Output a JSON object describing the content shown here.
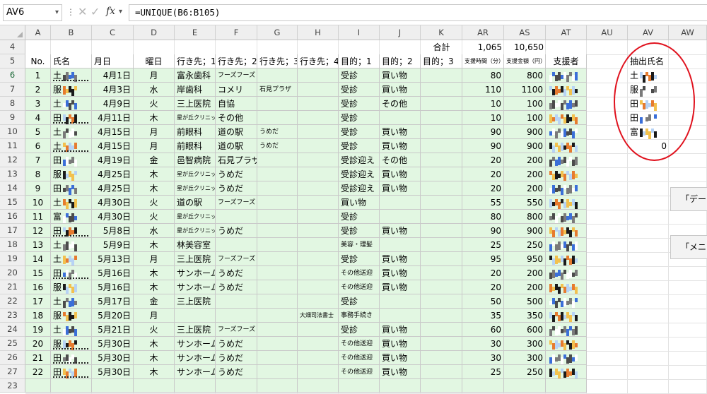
{
  "formula_bar": {
    "name_box": "AV6",
    "fx": "fx",
    "formula": "=UNIQUE(B6:B105)"
  },
  "columns": [
    {
      "key": "A",
      "label": "A"
    },
    {
      "key": "B",
      "label": "B"
    },
    {
      "key": "C",
      "label": "C"
    },
    {
      "key": "D",
      "label": "D"
    },
    {
      "key": "E",
      "label": "E"
    },
    {
      "key": "F",
      "label": "F"
    },
    {
      "key": "G",
      "label": "G"
    },
    {
      "key": "H",
      "label": "H"
    },
    {
      "key": "I",
      "label": "I"
    },
    {
      "key": "J",
      "label": "J"
    },
    {
      "key": "K",
      "label": "K"
    },
    {
      "key": "AR",
      "label": "AR"
    },
    {
      "key": "AS",
      "label": "AS"
    },
    {
      "key": "AT",
      "label": "AT"
    },
    {
      "key": "AU",
      "label": "AU"
    },
    {
      "key": "AV",
      "label": "AV"
    },
    {
      "key": "AW",
      "label": "AW"
    }
  ],
  "totals": {
    "label": "合計",
    "time": "1,065",
    "amount": "10,650"
  },
  "headers": {
    "no": "No.",
    "name": "氏名",
    "date": "月日",
    "weekday": "曜日",
    "dest1": "行き先；1",
    "dest2": "行き先；2",
    "dest3": "行き先；3",
    "dest4": "行き先；4",
    "purpose1": "目的；1",
    "purpose2": "目的；2",
    "purpose3": "目的；3",
    "time": "支援時間（分）",
    "amount": "支援金額（円）",
    "supporter": "支援者"
  },
  "extract": {
    "title": "抽出氏名",
    "names": [
      "土",
      "服",
      "田",
      "田",
      "富"
    ],
    "zero": "0"
  },
  "side_buttons": [
    "「デー",
    "「メニ"
  ],
  "rows": [
    {
      "row": "6",
      "no": "1",
      "name": "土",
      "date": "4月1日",
      "wd": "月",
      "d1": "富永歯科",
      "d2": "フーズフーズ",
      "d3": "",
      "d4": "",
      "p1": "受診",
      "p2": "買い物",
      "time": "80",
      "amt": "800"
    },
    {
      "row": "7",
      "no": "2",
      "name": "服",
      "date": "4月3日",
      "wd": "水",
      "d1": "岸歯科",
      "d2": "コメリ",
      "d3": "石見プラザ",
      "d4": "",
      "p1": "受診",
      "p2": "買い物",
      "time": "110",
      "amt": "1100"
    },
    {
      "row": "8",
      "no": "3",
      "name": "土",
      "date": "4月9日",
      "wd": "火",
      "d1": "三上医院",
      "d2": "自協",
      "d3": "",
      "d4": "",
      "p1": "受診",
      "p2": "その他",
      "time": "10",
      "amt": "100"
    },
    {
      "row": "9",
      "no": "4",
      "name": "田",
      "date": "4月11日",
      "wd": "木",
      "d1": "星が丘クリニック",
      "d2": "その他",
      "d3": "",
      "d4": "",
      "p1": "受診",
      "p2": "",
      "time": "10",
      "amt": "100"
    },
    {
      "row": "10",
      "no": "5",
      "name": "土",
      "date": "4月15日",
      "wd": "月",
      "d1": "前眼科",
      "d2": "道の駅",
      "d3": "うめだ",
      "d4": "",
      "p1": "受診",
      "p2": "買い物",
      "time": "90",
      "amt": "900"
    },
    {
      "row": "11",
      "no": "6",
      "name": "土",
      "date": "4月15日",
      "wd": "月",
      "d1": "前眼科",
      "d2": "道の駅",
      "d3": "うめだ",
      "d4": "",
      "p1": "受診",
      "p2": "買い物",
      "time": "90",
      "amt": "900"
    },
    {
      "row": "12",
      "no": "7",
      "name": "田",
      "date": "4月19日",
      "wd": "金",
      "d1": "邑智病院",
      "d2": "石見プラザ",
      "d3": "",
      "d4": "",
      "p1": "受診迎え",
      "p2": "その他",
      "time": "20",
      "amt": "200"
    },
    {
      "row": "13",
      "no": "8",
      "name": "服",
      "date": "4月25日",
      "wd": "木",
      "d1": "星が丘クリニック",
      "d2": "うめだ",
      "d3": "",
      "d4": "",
      "p1": "受診迎え",
      "p2": "買い物",
      "time": "20",
      "amt": "200"
    },
    {
      "row": "14",
      "no": "9",
      "name": "田",
      "date": "4月25日",
      "wd": "木",
      "d1": "星が丘クリニック",
      "d2": "うめだ",
      "d3": "",
      "d4": "",
      "p1": "受診迎え",
      "p2": "買い物",
      "time": "20",
      "amt": "200"
    },
    {
      "row": "15",
      "no": "10",
      "name": "土",
      "date": "4月30日",
      "wd": "火",
      "d1": "道の駅",
      "d2": "フーズフーズ",
      "d3": "",
      "d4": "",
      "p1": "買い物",
      "p2": "",
      "time": "55",
      "amt": "550"
    },
    {
      "row": "16",
      "no": "11",
      "name": "富",
      "date": "4月30日",
      "wd": "火",
      "d1": "星が丘クリニック",
      "d2": "",
      "d3": "",
      "d4": "",
      "p1": "受診",
      "p2": "",
      "time": "80",
      "amt": "800"
    },
    {
      "row": "17",
      "no": "12",
      "name": "田",
      "date": "5月8日",
      "wd": "水",
      "d1": "星が丘クリニック",
      "d2": "うめだ",
      "d3": "",
      "d4": "",
      "p1": "受診",
      "p2": "買い物",
      "time": "90",
      "amt": "900"
    },
    {
      "row": "18",
      "no": "13",
      "name": "土",
      "date": "5月9日",
      "wd": "木",
      "d1": "林美容室",
      "d2": "",
      "d3": "",
      "d4": "",
      "p1": "美容・理髪",
      "p2": "",
      "time": "25",
      "amt": "250"
    },
    {
      "row": "19",
      "no": "14",
      "name": "土",
      "date": "5月13日",
      "wd": "月",
      "d1": "三上医院",
      "d2": "フーズフーズ",
      "d3": "",
      "d4": "",
      "p1": "受診",
      "p2": "買い物",
      "time": "95",
      "amt": "950"
    },
    {
      "row": "20",
      "no": "15",
      "name": "田",
      "date": "5月16日",
      "wd": "木",
      "d1": "サンホーム",
      "d2": "うめだ",
      "d3": "",
      "d4": "",
      "p1": "その他送迎",
      "p2": "買い物",
      "time": "20",
      "amt": "200"
    },
    {
      "row": "21",
      "no": "16",
      "name": "服",
      "date": "5月16日",
      "wd": "木",
      "d1": "サンホーム",
      "d2": "うめだ",
      "d3": "",
      "d4": "",
      "p1": "その他送迎",
      "p2": "買い物",
      "time": "20",
      "amt": "200"
    },
    {
      "row": "22",
      "no": "17",
      "name": "土",
      "date": "5月17日",
      "wd": "金",
      "d1": "三上医院",
      "d2": "",
      "d3": "",
      "d4": "",
      "p1": "受診",
      "p2": "",
      "time": "50",
      "amt": "500"
    },
    {
      "row": "23",
      "no": "18",
      "name": "服",
      "date": "5月20日",
      "wd": "月",
      "d1": "",
      "d2": "",
      "d3": "",
      "d4": "大畑司法書士",
      "p1": "事務手続き",
      "p2": "",
      "time": "35",
      "amt": "350"
    },
    {
      "row": "24",
      "no": "19",
      "name": "土",
      "date": "5月21日",
      "wd": "火",
      "d1": "三上医院",
      "d2": "フーズフーズ",
      "d3": "",
      "d4": "",
      "p1": "受診",
      "p2": "買い物",
      "time": "60",
      "amt": "600"
    },
    {
      "row": "25",
      "no": "20",
      "name": "服",
      "date": "5月30日",
      "wd": "木",
      "d1": "サンホーム",
      "d2": "うめだ",
      "d3": "",
      "d4": "",
      "p1": "その他送迎",
      "p2": "買い物",
      "time": "30",
      "amt": "300"
    },
    {
      "row": "26",
      "no": "21",
      "name": "田",
      "date": "5月30日",
      "wd": "木",
      "d1": "サンホーム",
      "d2": "うめだ",
      "d3": "",
      "d4": "",
      "p1": "その他送迎",
      "p2": "買い物",
      "time": "30",
      "amt": "300"
    },
    {
      "row": "27",
      "no": "22",
      "name": "田",
      "date": "5月30日",
      "wd": "木",
      "d1": "サンホーム",
      "d2": "うめだ",
      "d3": "",
      "d4": "",
      "p1": "その他送迎",
      "p2": "買い物",
      "time": "25",
      "amt": "250"
    }
  ],
  "extra_rows": [
    "4",
    "5",
    "23"
  ],
  "colors": {
    "fill": "#e2f7e2",
    "oval": "#e0121e",
    "grid": "#c9c9c9"
  }
}
